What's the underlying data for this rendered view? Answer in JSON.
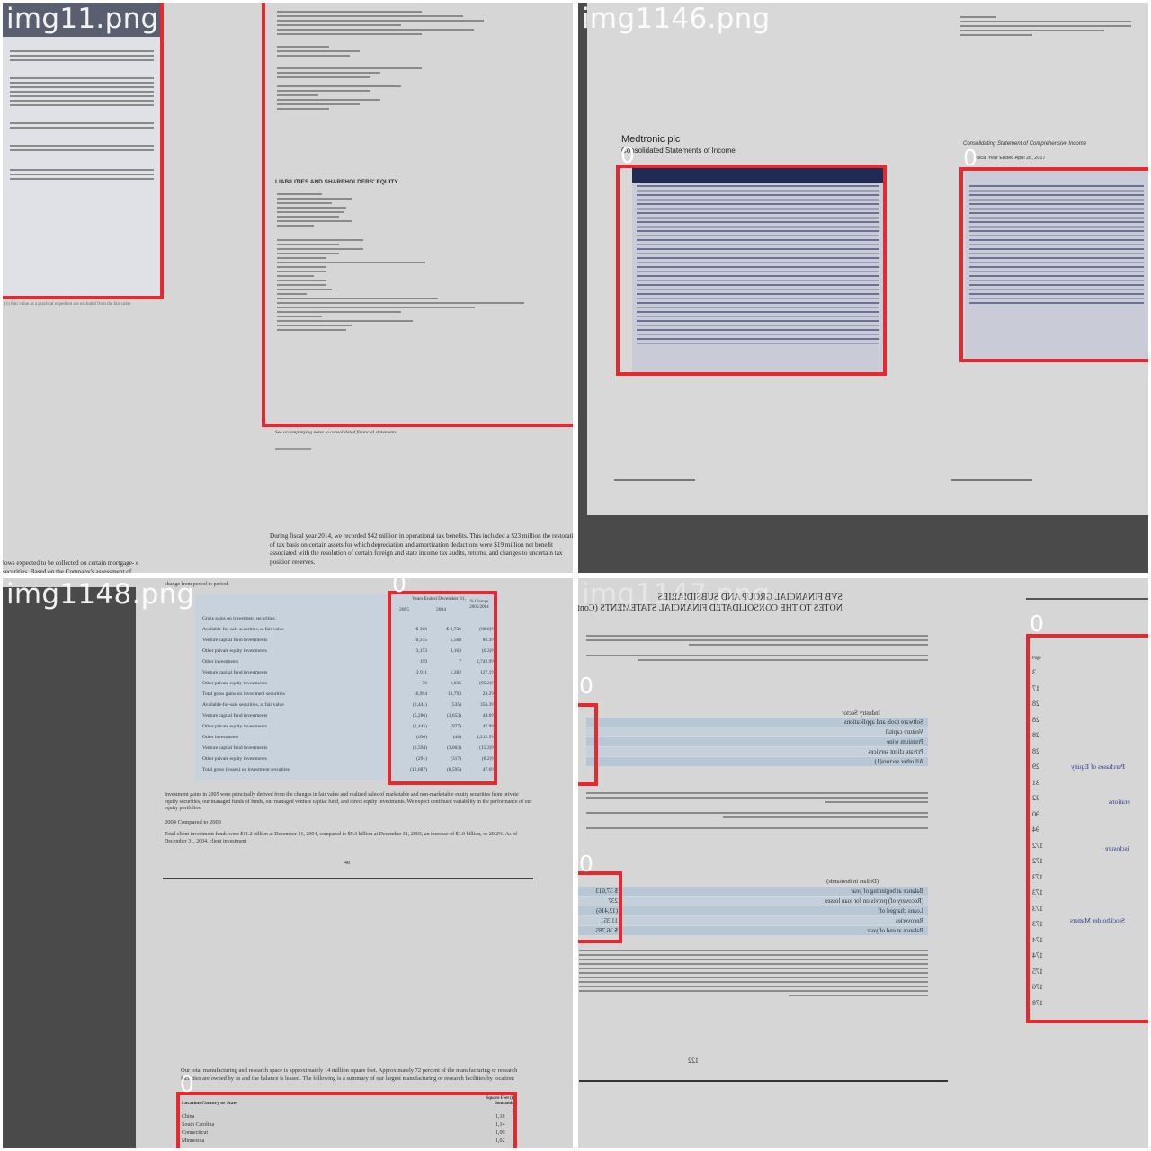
{
  "tiles": [
    {
      "filename": "img11.png",
      "label": "0"
    },
    {
      "filename": "img1146.png",
      "label": "0"
    },
    {
      "filename": "img1148.png",
      "label": "0"
    },
    {
      "filename": "img1147.png",
      "label": "0"
    }
  ],
  "t1": {
    "liabilities_heading": "LIABILITIES AND SHAREHOLDERS' EQUITY",
    "note": "See accompanying notes to consolidated financial statements.",
    "paragraph": "During fiscal year 2014, we recorded $42 million in operational tax benefits. This included a $23 million the restoration of tax basis on certain assets for which depreciation and amortization deductions were $19 million net benefit associated with the resolution of certain foreign and state income tax audits, returns, and changes to uncertain tax position reserves.",
    "left_note": "lows expected to be collected on certain mortgage- e securities. Based on the Company's assessment of"
  },
  "t2": {
    "company": "Medtronic plc",
    "statement": "Consolidated Statements of Income",
    "right_title": "Consolidating Statement of Comprehensive Income",
    "right_sub": "Fiscal Year Ended April 28, 2017"
  },
  "t3": {
    "caption": "change from period to period:",
    "table_header": "Years Ended December 31,",
    "cols": [
      "2005",
      "2004",
      "% Change 2005/2004"
    ],
    "rows": [
      {
        "label": "Gross gains on investment securities:",
        "v": [
          "",
          "",
          ""
        ]
      },
      {
        "label": "Available-for-sale securities, at fair value",
        "v": [
          "$ 306",
          "$ 2,736",
          "(88.8)%"
        ]
      },
      {
        "label": "Venture capital fund investments",
        "v": [
          "10,375",
          "5,568",
          "86.3%"
        ]
      },
      {
        "label": "Other private equity investments",
        "v": [
          "3,153",
          "3,163",
          "(0.3)%"
        ]
      },
      {
        "label": "Other investments",
        "v": [
          "199",
          "7",
          "2,742.9%"
        ]
      },
      {
        "label": "Venture capital fund investments",
        "v": [
          "2,911",
          "1,282",
          "127.1%"
        ]
      },
      {
        "label": "Other private equity investments",
        "v": [
          "50",
          "1,035",
          "(95.2)%"
        ]
      },
      {
        "label": "Total gross gains on investment securities",
        "v": [
          "16,994",
          "13,793",
          "23.2%"
        ]
      },
      {
        "label": "Available-for-sale securities, at fair value",
        "v": [
          "(2,441)",
          "(535)",
          "356.3%"
        ]
      },
      {
        "label": "Venture capital fund investments",
        "v": [
          "(5,286)",
          "(3,653)",
          "44.6%"
        ]
      },
      {
        "label": "Other private equity investments",
        "v": [
          "(1,445)",
          "(977)",
          "47.9%"
        ]
      },
      {
        "label": "Other investments",
        "v": [
          "(630)",
          "(48)",
          "1,212.5%"
        ]
      },
      {
        "label": "Venture capital fund investments",
        "v": [
          "(2,594)",
          "(3,063)",
          "(15.3)%"
        ]
      },
      {
        "label": "Other private equity investments",
        "v": [
          "(291)",
          "(317)",
          "(8.2)%"
        ]
      },
      {
        "label": "Total gross (losses) on investment securities",
        "v": [
          "(12,687)",
          "(8,595)",
          "47.6%"
        ]
      }
    ],
    "para1": "Investment gains in 2005 were principally derived from the changes in fair value and realized sales of marketable and non-marketable equity securities from private equity securities, our managed funds of funds, our managed venture capital fund, and direct equity investments. We expect continued variability in the performance of our equity portfolios.",
    "sub": "2004 Compared to 2003",
    "para2": "Total client investment funds were $11.2 billion at December 31, 2004, compared to $9.3 billion at December 31, 2003, an increase of $1.9 billion, or 20.2%. As of December 31, 2004, client investment",
    "page_no": "48",
    "para3": "Our total manufacturing and research space is approximately 14 million square feet. Approximately 72 percent of the manufacturing or research facilities are owned by us and the balance is leased. The following is a summary of our largest manufacturing or research facilities by location:",
    "loc_header": "Location Country or State",
    "sq_header": "Square Feet (in thousands)",
    "locations": [
      {
        "name": "China",
        "v": "1,18"
      },
      {
        "name": "South Carolina",
        "v": "1,14"
      },
      {
        "name": "Connecticut",
        "v": "1,09"
      },
      {
        "name": "Minnesota",
        "v": "1,02"
      }
    ]
  },
  "t4": {
    "header1": "SVB FINANCIAL GROUP AND SUBSIDIARIES",
    "header2": "NOTES TO THE CONSOLIDATED FINANCIAL STATEMENTS (Continued)",
    "industry_header": "Industry Sector",
    "industries": [
      "Software tools and applications",
      "Venture capital",
      "Premium wine",
      "Private client services",
      "All other sectors(1)"
    ],
    "allowance_header": "(Dollars in thousands)",
    "allowance_rows": [
      {
        "label": "Balance at beginning of year",
        "v": "$ 37,613"
      },
      {
        "label": "(Recovery of) provision for loan losses",
        "v": "237"
      },
      {
        "label": "Loans charged off",
        "v": "(12,416)"
      },
      {
        "label": "Recoveries",
        "v": "11,351"
      },
      {
        "label": "Balance at end of year",
        "v": "$ 36,785"
      }
    ],
    "page_no": "122",
    "toc_header": "Page",
    "toc_pages": [
      "3",
      "17",
      "28",
      "28",
      "28",
      "28",
      "29",
      "31",
      "32",
      "90",
      "94",
      "172",
      "172",
      "173",
      "173",
      "173",
      "173",
      "174",
      "174",
      "175",
      "176",
      "178"
    ],
    "toc_items": [
      "Purchases of Equity",
      "erations",
      "isclosure",
      "Stockholder Matters"
    ]
  }
}
